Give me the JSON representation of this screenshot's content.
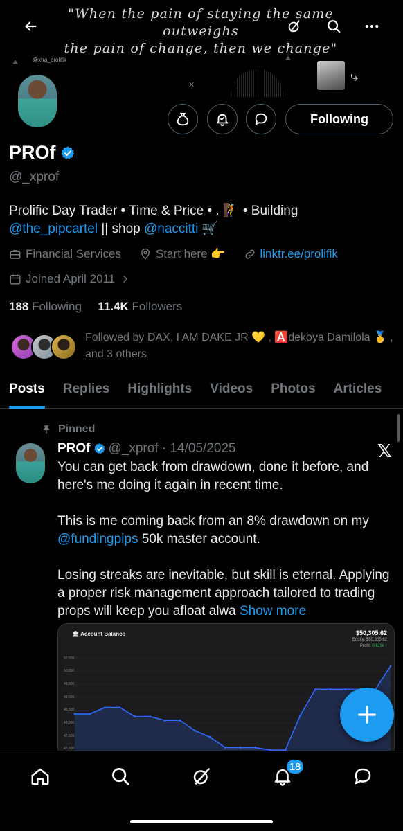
{
  "banner": {
    "quote_line1": "\"When the pain of staying the same outweighs",
    "quote_line2": "the pain of change, then we change\"",
    "tag": "@xtra_prolifik"
  },
  "profile": {
    "name": "PROf",
    "handle": "@_xprof",
    "follow_label": "Following",
    "bio_line1": "Prolific Day Trader • Time & Price • . 🧗 • Building",
    "bio_mention1": "@the_pipcartel",
    "bio_mid": " || shop ",
    "bio_mention2": "@naccitti",
    "bio_end": " 🛒",
    "category": "Financial Services",
    "location": "Start here 👉",
    "website": "linktr.ee/prolifik",
    "joined": "Joined April 2011",
    "following_count": "188",
    "following_label": " Following",
    "followers_count": "11.4K",
    "followers_label": " Followers",
    "followed_by": "Followed by DAX, I AM DAKE JR 💛 , 🅰️dekoya Damilola 🥇 , and 3 others"
  },
  "tabs": [
    "Posts",
    "Replies",
    "Highlights",
    "Videos",
    "Photos",
    "Articles"
  ],
  "post": {
    "pinned_label": "Pinned",
    "name": "PROf",
    "meta": "@_xprof · 14/05/2025",
    "text_line1": "You can get back from drawdown, done it before, and here's me doing it again in recent time.",
    "text_line2_pre": "This is me coming back from an 8% drawdown on my ",
    "text_mention": "@fundingpips",
    "text_line2_post": " 50k master account.",
    "text_line3": "Losing streaks are inevitable, but skill is eternal. Applying a proper risk management approach tailored to trading props will keep you afloat alwa ",
    "show_more": "Show more"
  },
  "chart_data": {
    "type": "line",
    "title": "Account Balance",
    "balance": "$50,305.62",
    "equity": "Equity:  $50,305.62",
    "profit_label": "Profit: ",
    "profit_value": "0.61% ↑",
    "yticks": [
      "50,500",
      "50,000",
      "49,500",
      "49,000",
      "48,500",
      "48,000",
      "47,500",
      "47,000"
    ],
    "ylim": [
      46900,
      50600
    ],
    "values": [
      48350,
      48350,
      48600,
      48600,
      48250,
      48250,
      48100,
      48100,
      47700,
      47450,
      47050,
      47050,
      47050,
      46950,
      46950,
      48300,
      49300,
      49300,
      49300,
      49300,
      49300,
      50200
    ]
  },
  "nav": {
    "badge": "18"
  },
  "colors": {
    "accent": "#1d9bf0",
    "muted": "#71767b",
    "bg": "#000000"
  }
}
